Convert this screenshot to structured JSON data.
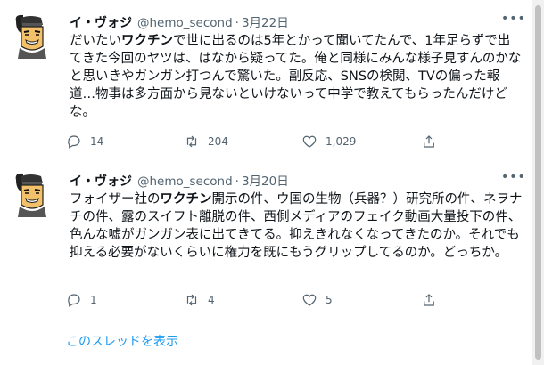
{
  "tweets": [
    {
      "name": "イ・ヴォジ",
      "handle": "@hemo_second",
      "dot": "·",
      "date": "3月22日",
      "text_before": "だいたい",
      "text_bold": "ワクチン",
      "text_after": "で世に出るのは5年とかって聞いてたんで、1年足らずで出てきた今回のヤツは、はなから疑ってた。俺と同様にみんな様子見すんのかなと思いきやガンガン打つんで驚いた。副反応、SNSの検閲、TVの偏った報道…物事は多方面から見ないといけないって中学で教えてもらったんだけどな。",
      "replies": "14",
      "retweets": "204",
      "likes": "1,029"
    },
    {
      "name": "イ・ヴォジ",
      "handle": "@hemo_second",
      "dot": "·",
      "date": "3月20日",
      "text_before": "フォイザー社の",
      "text_bold": "ワクチン",
      "text_after": "開示の件、ウ国の生物（兵器？）研究所の件、ネヲナチの件、露のスイフト離脱の件、西側メディアのフェイク動画大量投下の件、色んな嘘がガンガン表に出てきてる。抑えきれなくなってきたのか。それでも抑える必要がないくらいに権力を既にもうグリップしてるのか。どっちか。",
      "replies": "1",
      "retweets": "4",
      "likes": "5"
    }
  ],
  "thread_link": "このスレッドを表示",
  "colors": {
    "accent": "#1d9bf0",
    "muted": "#536471",
    "text": "#0f1419"
  },
  "icons": [
    "reply-icon",
    "retweet-icon",
    "like-icon",
    "share-icon",
    "more-icon",
    "avatar"
  ]
}
